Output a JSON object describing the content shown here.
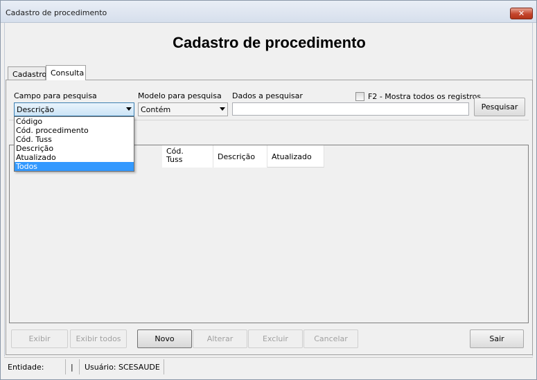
{
  "window": {
    "title": "Cadastro de procedimento",
    "close_label": "✕"
  },
  "header": {
    "title": "Cadastro de procedimento"
  },
  "tabs": [
    {
      "label": "Cadastro"
    },
    {
      "label": "Consulta"
    }
  ],
  "search": {
    "field_label": "Campo para pesquisa",
    "field_value": "Descrição",
    "model_label": "Modelo para pesquisa",
    "model_value": "Contém",
    "data_label": "Dados a pesquisar",
    "data_value": "",
    "show_all_label": "F2 - Mostra todos os registros",
    "search_button": "Pesquisar"
  },
  "dropdown": {
    "options": [
      "Código",
      "Cód. procedimento",
      "Cód. Tuss",
      "Descrição",
      "Atualizado",
      "Todos"
    ],
    "highlighted_index": 5
  },
  "grid": {
    "columns": [
      "Cód.\nTuss",
      "Descrição",
      "Atualizado"
    ]
  },
  "actions": {
    "exibir": "Exibir",
    "exibir_todos": "Exibir todos",
    "novo": "Novo",
    "alterar": "Alterar",
    "excluir": "Excluir",
    "cancelar": "Cancelar",
    "sair": "Sair"
  },
  "status": {
    "entidade": "Entidade:",
    "pipe": "|",
    "usuario": "Usuário: SCESAUDE"
  },
  "icons": {
    "dropdown": "chevron-down-icon",
    "close": "close-icon"
  }
}
